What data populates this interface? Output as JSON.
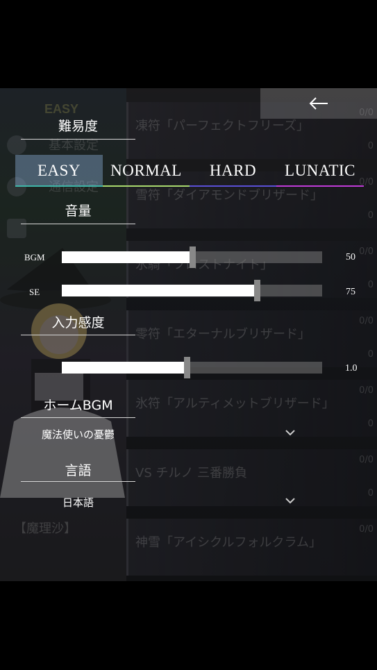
{
  "background": {
    "logo": "EASY",
    "menu": [
      {
        "label": "基本設定",
        "icon": "gear-icon"
      },
      {
        "label": "通信設定",
        "icon": "globe-icon"
      },
      {
        "label": "",
        "icon": "trophy-icon"
      }
    ],
    "character": "【魔理沙】",
    "spells": [
      {
        "name": "凍符「パーフェクトフリーズ」",
        "count1": "0/0",
        "count2": "0"
      },
      {
        "name": "雪符「ダイアモンドブリザード」",
        "count1": "0/0",
        "count2": "0"
      },
      {
        "name": "氷騎「フロストナイト」",
        "count1": "0/0",
        "count2": "0"
      },
      {
        "name": "零符「エターナルブリザード」",
        "count1": "0/0",
        "count2": "0"
      },
      {
        "name": "氷符「アルティメットブリザード」",
        "count1": "0/0",
        "count2": "0"
      },
      {
        "name": "VS チルノ 三番勝負",
        "count1": "0/0",
        "count2": "0"
      },
      {
        "name": "神雪「アイシクルフォルクラム」",
        "count1": "0/0",
        "count2": ""
      }
    ]
  },
  "settings": {
    "back_icon": "arrow-left-icon",
    "difficulty": {
      "heading": "難易度",
      "options": [
        "EASY",
        "NORMAL",
        "HARD",
        "LUNATIC"
      ],
      "selected": "EASY",
      "underline_colors": [
        "#3fb6a8",
        "#a9d96e",
        "#5a4fd6",
        "#c03bd8"
      ]
    },
    "volume": {
      "heading": "音量",
      "bgm": {
        "label": "BGM",
        "value": 50,
        "display": "50"
      },
      "se": {
        "label": "SE",
        "value": 75,
        "display": "75"
      }
    },
    "sensitivity": {
      "heading": "入力感度",
      "value": 1.0,
      "fraction": 0.48,
      "display": "1.0"
    },
    "home_bgm": {
      "heading": "ホームBGM",
      "selected": "魔法使いの憂鬱"
    },
    "language": {
      "heading": "言語",
      "selected": "日本語"
    }
  }
}
